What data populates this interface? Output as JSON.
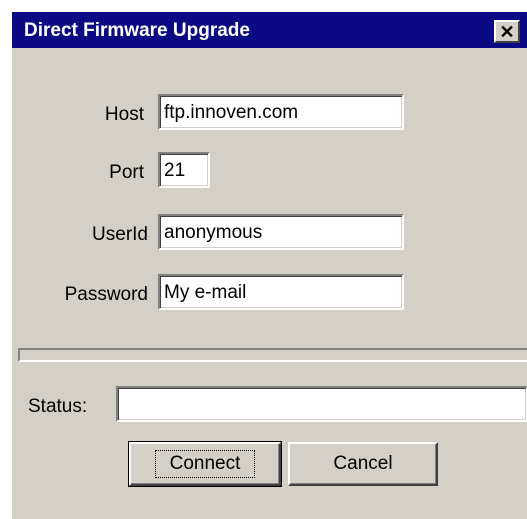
{
  "window": {
    "title": "Direct Firmware Upgrade",
    "close_glyph": "✕",
    "colors": {
      "titlebar": "#0a0a84",
      "face": "#d4d0c8"
    }
  },
  "form": {
    "host": {
      "label": "Host",
      "value": "ftp.innoven.com"
    },
    "port": {
      "label": "Port",
      "value": "21"
    },
    "userid": {
      "label": "UserId",
      "value": "anonymous"
    },
    "password": {
      "label": "Password",
      "value": "My e-mail"
    }
  },
  "progress": {
    "value": 0
  },
  "status": {
    "label": "Status:",
    "value": ""
  },
  "buttons": {
    "connect": "Connect",
    "cancel": "Cancel"
  }
}
